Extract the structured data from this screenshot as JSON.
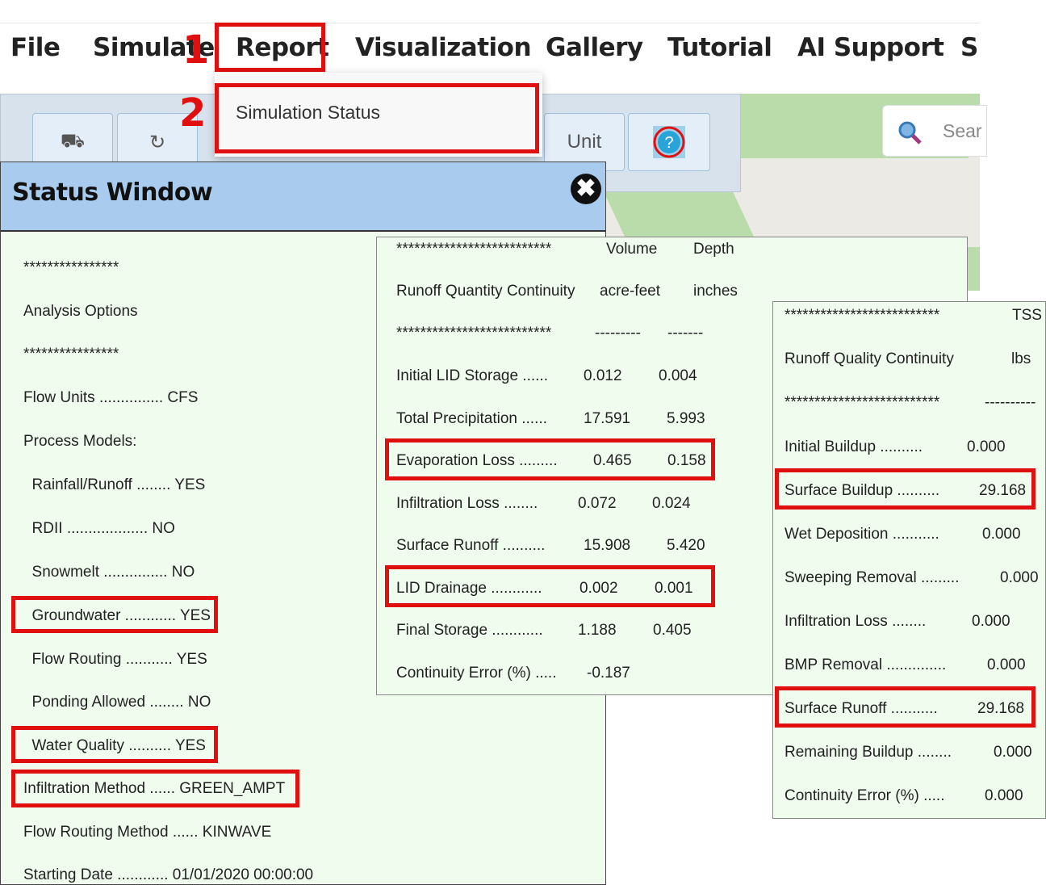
{
  "menu": {
    "items": [
      "File",
      "Simulate",
      "Report",
      "Visualization",
      "Gallery",
      "Tutorial",
      "AI Support",
      "Su"
    ]
  },
  "steps": {
    "step1": "1",
    "step2": "2"
  },
  "dropdown": {
    "item": "Simulation Status"
  },
  "toolbar": {
    "unit_label": "Unit",
    "search_placeholder": "Sear"
  },
  "colors": {
    "highlight": "#e01010",
    "panel_bg": "#effcee",
    "header_bg": "#a9cbee"
  },
  "status_window": {
    "title": "Status Window",
    "lines": [
      "****************",
      "Analysis Options",
      "****************",
      "Flow Units ............... CFS",
      "Process Models:",
      "  Rainfall/Runoff ........ YES",
      "  RDII ................... NO",
      "  Snowmelt ............... NO",
      "  Groundwater ............ YES",
      "  Flow Routing ........... YES",
      "  Ponding Allowed ........ NO",
      "  Water Quality .......... YES",
      "Infiltration Method ...... GREEN_AMPT",
      "Flow Routing Method ...... KINWAVE",
      "Starting Date ............ 01/01/2020 00:00:00"
    ]
  },
  "runoff_quantity": {
    "header_stars": "**************************",
    "col_volume": "Volume",
    "col_depth": "Depth",
    "title": "Runoff Quantity Continuity",
    "unit_volume": "acre-feet",
    "unit_depth": "inches",
    "sep_stars": "**************************",
    "sep_volume": "---------",
    "sep_depth": "-------",
    "rows": [
      {
        "label": "Initial LID Storage ......",
        "volume": "0.012",
        "depth": "0.004"
      },
      {
        "label": "Total Precipitation ......",
        "volume": "17.591",
        "depth": "5.993"
      },
      {
        "label": "Evaporation Loss .........",
        "volume": "0.465",
        "depth": "0.158"
      },
      {
        "label": "Infiltration Loss ........",
        "volume": "0.072",
        "depth": "0.024"
      },
      {
        "label": "Surface Runoff ..........",
        "volume": "15.908",
        "depth": "5.420"
      },
      {
        "label": "LID Drainage ............",
        "volume": "0.002",
        "depth": "0.001"
      },
      {
        "label": "Final Storage ............",
        "volume": "1.188",
        "depth": "0.405"
      },
      {
        "label": "Continuity Error (%) .....",
        "volume": "-0.187",
        "depth": ""
      }
    ]
  },
  "runoff_quality": {
    "header_stars": "**************************",
    "col_tss": "TSS",
    "title": "Runoff Quality Continuity",
    "unit": "lbs",
    "sep_stars": "**************************",
    "sep_tss": "----------",
    "rows": [
      {
        "label": "Initial Buildup ..........",
        "value": "0.000"
      },
      {
        "label": "Surface Buildup ..........",
        "value": "29.168"
      },
      {
        "label": "Wet Deposition ...........",
        "value": "0.000"
      },
      {
        "label": "Sweeping Removal .........",
        "value": "0.000"
      },
      {
        "label": "Infiltration Loss ........",
        "value": "0.000"
      },
      {
        "label": "BMP Removal ..............",
        "value": "0.000"
      },
      {
        "label": "Surface Runoff ...........",
        "value": "29.168"
      },
      {
        "label": "Remaining Buildup ........",
        "value": "0.000"
      },
      {
        "label": "Continuity Error (%) .....",
        "value": "0.000"
      }
    ]
  }
}
